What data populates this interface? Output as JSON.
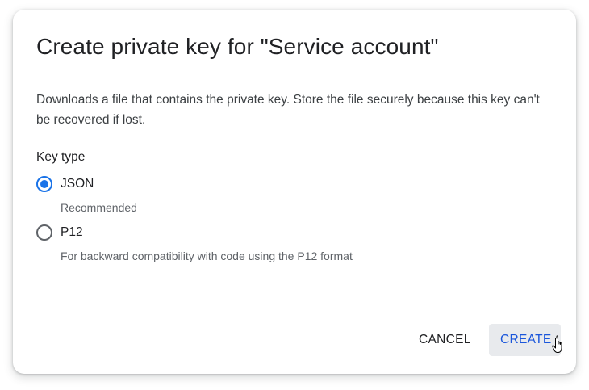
{
  "dialog": {
    "title": "Create private key for \"Service account\"",
    "description": "Downloads a file that contains the private key. Store the file securely because this key can't be recovered if lost.",
    "key_type_label": "Key type",
    "options": [
      {
        "label": "JSON",
        "hint": "Recommended",
        "selected": true
      },
      {
        "label": "P12",
        "hint": "For backward compatibility with code using the P12 format",
        "selected": false
      }
    ],
    "buttons": {
      "cancel": "CANCEL",
      "create": "CREATE"
    }
  },
  "colors": {
    "accent": "#1a73e8",
    "create_text": "#1a56db",
    "create_bg": "#e8eaed"
  },
  "cursor": "hand-pointer-icon"
}
